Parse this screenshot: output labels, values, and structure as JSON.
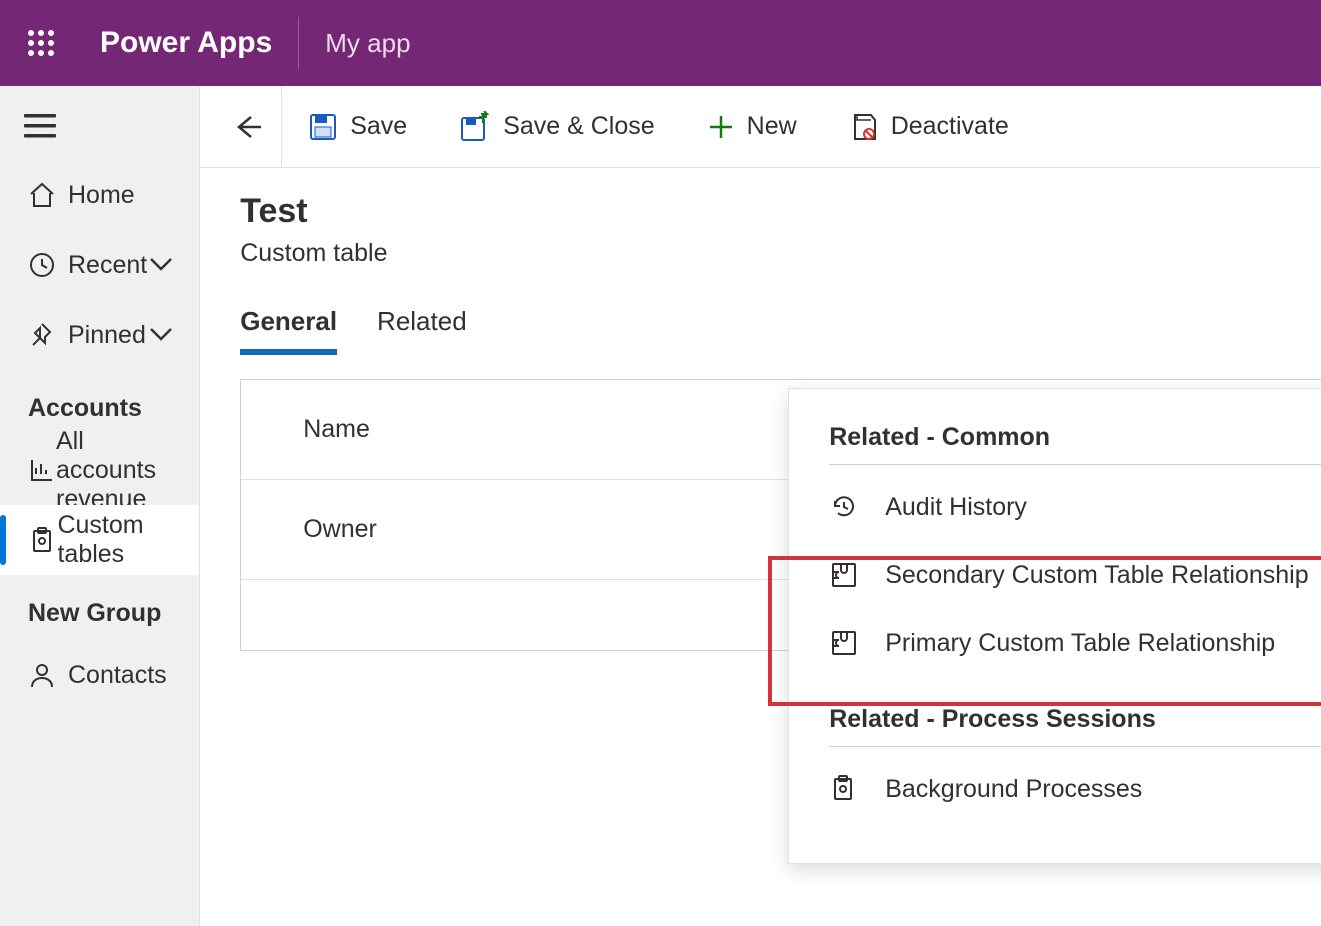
{
  "header": {
    "app_name": "Power Apps",
    "context": "My app"
  },
  "sidebar": {
    "primary": [
      {
        "label": "Home",
        "icon": "home-icon"
      },
      {
        "label": "Recent",
        "icon": "clock-icon",
        "chevron": true
      },
      {
        "label": "Pinned",
        "icon": "pin-icon",
        "chevron": true
      }
    ],
    "groups": [
      {
        "title": "Accounts",
        "items": [
          {
            "label": "All accounts revenue",
            "icon": "chart-icon",
            "active": false
          },
          {
            "label": "Custom tables",
            "icon": "clipboard-icon",
            "active": true
          }
        ]
      },
      {
        "title": "New Group",
        "items": [
          {
            "label": "Contacts",
            "icon": "person-icon",
            "active": false
          }
        ]
      }
    ]
  },
  "commands": {
    "save": "Save",
    "save_close": "Save & Close",
    "new": "New",
    "deactivate": "Deactivate"
  },
  "page": {
    "title": "Test",
    "subtitle": "Custom table"
  },
  "tabs": [
    {
      "label": "General",
      "active": true
    },
    {
      "label": "Related",
      "active": false
    }
  ],
  "form": {
    "rows": [
      {
        "label": "Name"
      },
      {
        "label": "Owner"
      }
    ]
  },
  "related_panel": {
    "sections": [
      {
        "heading": "Related - Common",
        "items": [
          {
            "label": "Audit History",
            "icon": "history-icon"
          },
          {
            "label": "Secondary Custom Table Relationship",
            "icon": "puzzle-icon"
          },
          {
            "label": "Primary Custom Table Relationship",
            "icon": "puzzle-icon"
          }
        ]
      },
      {
        "heading": "Related - Process Sessions",
        "items": [
          {
            "label": "Background Processes",
            "icon": "clipboard-icon"
          }
        ]
      }
    ]
  }
}
